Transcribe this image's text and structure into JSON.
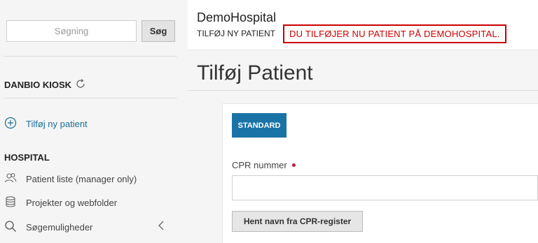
{
  "sidebar": {
    "search": {
      "placeholder": "Søgning",
      "button_label": "Søg"
    },
    "kiosk_title": "DANBIO KIOSK",
    "add_patient_label": "Tilføj ny patient",
    "section_title": "HOSPITAL",
    "items": [
      {
        "label": "Patient liste (manager only)",
        "icon": "users-icon"
      },
      {
        "label": "Projekter og webfolder",
        "icon": "database-icon"
      },
      {
        "label": "Søgemuligheder",
        "icon": "search-icon"
      }
    ]
  },
  "header": {
    "hospital_name": "DemoHospital",
    "subtitle": "TILFØJ NY PATIENT",
    "alert": "DU TILFØJER NU PATIENT PÅ DEMOHOSPITAL."
  },
  "main": {
    "page_title": "Tilføj Patient",
    "tab_label": "STANDARD",
    "cpr_label": "CPR nummer",
    "cpr_value": "",
    "fetch_button_label": "Hent navn fra CPR-register"
  },
  "colors": {
    "accent": "#1a73a7",
    "link": "#1a6e96",
    "alert": "#cc0000",
    "required": "#b5223d"
  }
}
